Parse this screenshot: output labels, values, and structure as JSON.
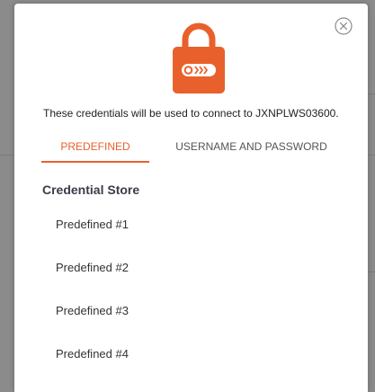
{
  "modal": {
    "intro_text": "These credentials will be used to connect to JXNPLWS03600.",
    "tabs": [
      {
        "label": "PREDEFINED",
        "active": true
      },
      {
        "label": "USERNAME AND PASSWORD",
        "active": false
      }
    ],
    "section_title": "Credential Store",
    "credentials": [
      {
        "label": "Predefined #1"
      },
      {
        "label": "Predefined #2"
      },
      {
        "label": "Predefined #3"
      },
      {
        "label": "Predefined #4"
      }
    ]
  },
  "icons": {
    "close": "close-circle-icon",
    "header": "lock-icon"
  },
  "colors": {
    "accent": "#e8612c",
    "title": "#3b3b4a",
    "overlay": "#8c8c8c"
  }
}
